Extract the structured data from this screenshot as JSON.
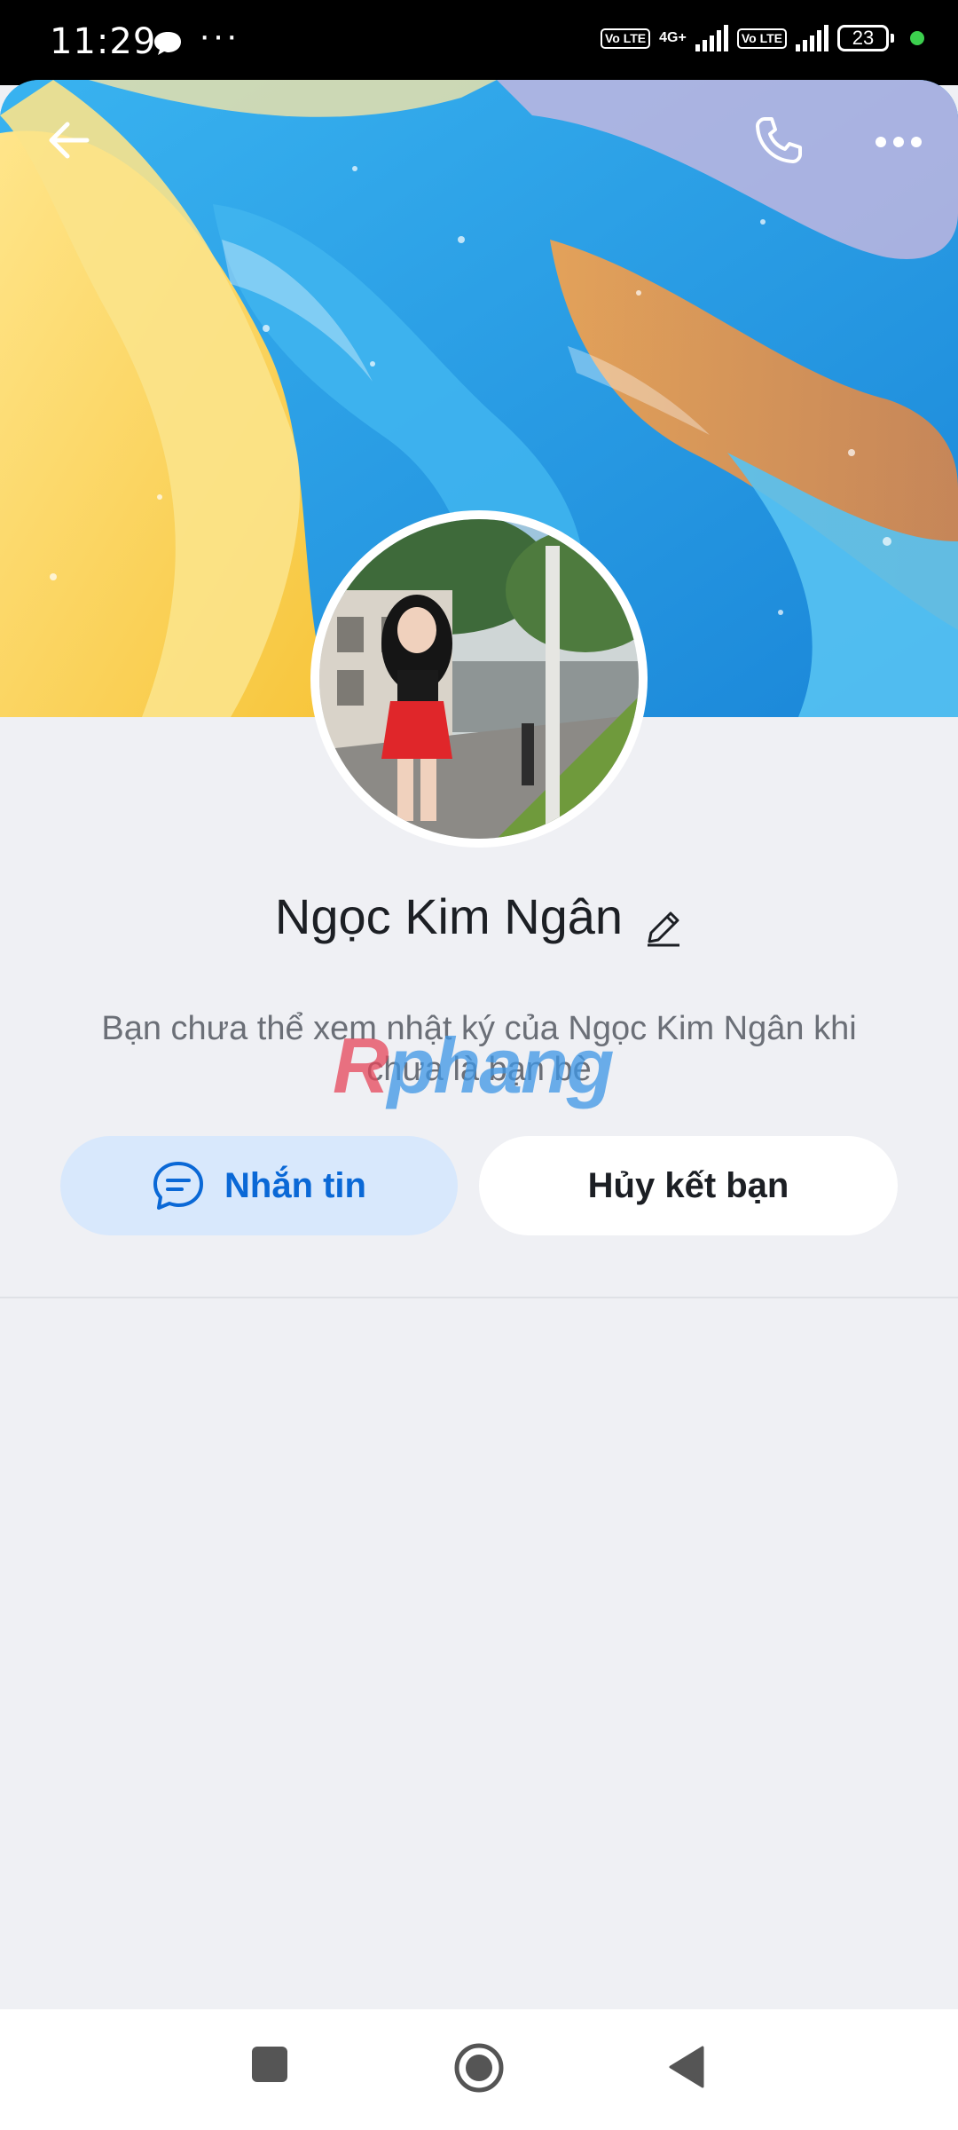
{
  "status_bar": {
    "time": "11:29",
    "dots": "···",
    "volte_1": "Vo LTE",
    "network": "4G+",
    "volte_2": "Vo LTE",
    "battery": "23"
  },
  "header": {
    "back_icon": "arrow-left-icon",
    "call_icon": "phone-icon",
    "more_icon": "more-horizontal-icon"
  },
  "profile": {
    "name": "Ngọc Kim Ngân",
    "edit_icon": "pencil-icon",
    "notice": "Bạn chưa thể xem nhật ký của Ngọc Kim Ngân khi chưa là bạn bè",
    "watermark_part1": "R",
    "watermark_part2": "phang"
  },
  "actions": {
    "message_label": "Nhắn tin",
    "message_icon": "chat-bubble-icon",
    "unfriend_label": "Hủy kết bạn"
  },
  "nav": {
    "recent_icon": "square-icon",
    "home_icon": "circle-icon",
    "back_icon": "triangle-back-icon"
  },
  "colors": {
    "accent": "#0a68d6",
    "accent_bg": "#d8e8fc",
    "page_bg": "#eff0f4"
  }
}
